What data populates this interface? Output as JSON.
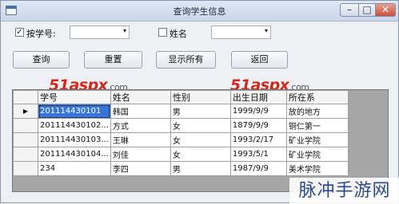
{
  "window": {
    "title": "查询学生信息"
  },
  "filters": {
    "by_id_checked": true,
    "by_id_label": "按学号:",
    "by_name_checked": false,
    "by_name_label": "姓名",
    "id_value": "",
    "name_value": ""
  },
  "buttons": {
    "query": "查询",
    "reset": "重置",
    "show_all": "显示所有",
    "back": "返回"
  },
  "watermark": {
    "brand": "51aspx",
    "suffix": ".com"
  },
  "grid": {
    "columns": [
      "学号",
      "姓名",
      "性别",
      "出生日期",
      "所在系"
    ],
    "rows": [
      [
        "201114430101",
        "韩国",
        "男",
        "1999/9/9",
        "放的地方"
      ],
      [
        "201114430102...",
        "方式",
        "女",
        "1879/9/9",
        "铜仁第一"
      ],
      [
        "201114430103...",
        "王琳",
        "女",
        "1993/2/17",
        "矿业学院"
      ],
      [
        "201114430104...",
        "刘佳",
        "女",
        "1993/5/1",
        "矿业学院"
      ],
      [
        "234",
        "李四",
        "男",
        "1987/9/9",
        "美术学院"
      ]
    ],
    "selected_row": 0,
    "row_indicator": "▶"
  },
  "corner_watermark": "脉冲手游网",
  "icons": {
    "minimize": "–",
    "maximize": "□",
    "close": "✕",
    "checkbox_checked": "✓",
    "dropdown": "▾"
  }
}
